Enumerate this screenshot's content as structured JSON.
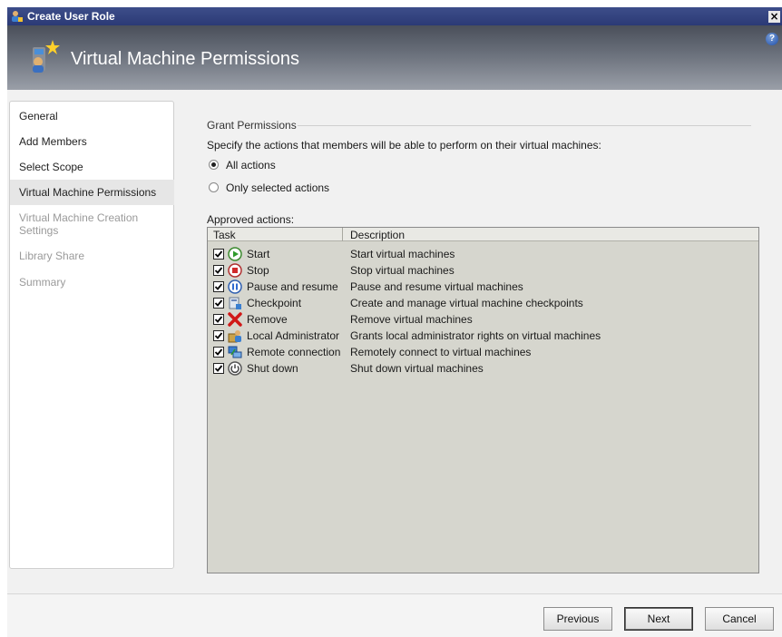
{
  "window": {
    "title": "Create User Role",
    "close_glyph": "×",
    "help_glyph": "?"
  },
  "header": {
    "title": "Virtual Machine Permissions",
    "icon": "user-role-icon"
  },
  "sidebar": {
    "items": [
      {
        "label": "General",
        "state": "normal"
      },
      {
        "label": "Add Members",
        "state": "normal"
      },
      {
        "label": "Select Scope",
        "state": "normal"
      },
      {
        "label": "Virtual Machine Permissions",
        "state": "active"
      },
      {
        "label": "Virtual Machine Creation Settings",
        "state": "disabled"
      },
      {
        "label": "Library Share",
        "state": "disabled"
      },
      {
        "label": "Summary",
        "state": "disabled"
      }
    ]
  },
  "main": {
    "group_label": "Grant Permissions",
    "instructions": "Specify the actions that members will be able to perform on their virtual machines:",
    "radio_all": "All actions",
    "radio_selected": "Only selected actions",
    "selected_option": "all",
    "approved_label": "Approved actions:",
    "columns": {
      "task": "Task",
      "description": "Description"
    },
    "actions": [
      {
        "task": "Start",
        "description": "Start virtual machines",
        "icon": "start-icon",
        "checked": true
      },
      {
        "task": "Stop",
        "description": "Stop virtual machines",
        "icon": "stop-icon",
        "checked": true
      },
      {
        "task": "Pause and resume",
        "description": "Pause and resume virtual machines",
        "icon": "pause-icon",
        "checked": true
      },
      {
        "task": "Checkpoint",
        "description": "Create and manage virtual machine checkpoints",
        "icon": "checkpoint-icon",
        "checked": true
      },
      {
        "task": "Remove",
        "description": "Remove virtual machines",
        "icon": "remove-icon",
        "checked": true
      },
      {
        "task": "Local Administrator",
        "description": "Grants local administrator rights on virtual machines",
        "icon": "local-admin-icon",
        "checked": true
      },
      {
        "task": "Remote connection",
        "description": "Remotely connect to virtual machines",
        "icon": "remote-connection-icon",
        "checked": true
      },
      {
        "task": "Shut down",
        "description": "Shut down virtual machines",
        "icon": "shutdown-icon",
        "checked": true
      }
    ]
  },
  "footer": {
    "previous": "Previous",
    "next": "Next",
    "cancel": "Cancel"
  }
}
